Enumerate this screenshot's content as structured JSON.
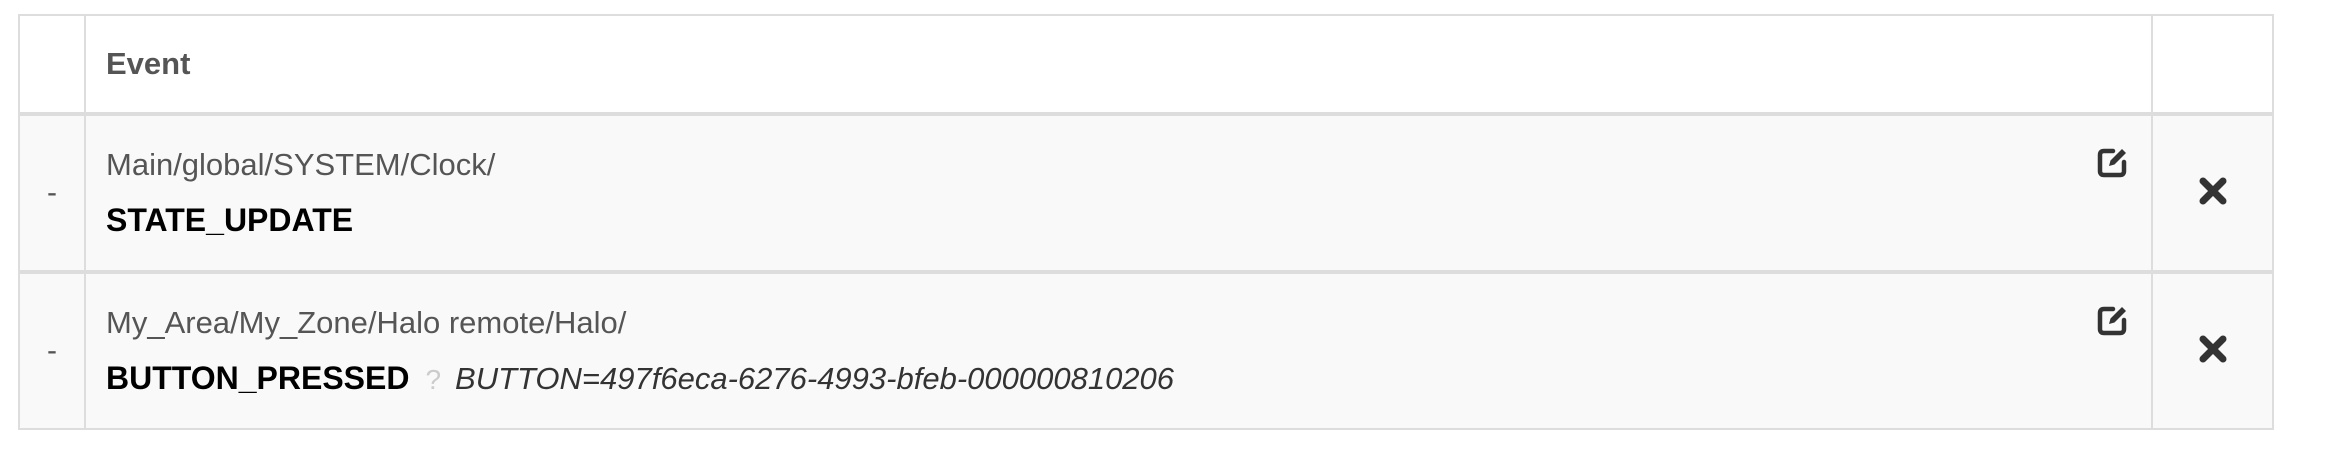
{
  "table": {
    "header": {
      "dash": "",
      "event": "Event",
      "actions": ""
    },
    "rows": [
      {
        "marker": "-",
        "path": "Main/global/SYSTEM/Clock/",
        "event_name": "STATE_UPDATE",
        "filter_separator": "",
        "filter": "",
        "edit_icon": "edit-icon",
        "delete_icon": "close-icon"
      },
      {
        "marker": "-",
        "path": "My_Area/My_Zone/Halo remote/Halo/",
        "event_name": "BUTTON_PRESSED",
        "filter_separator": "?",
        "filter": "BUTTON=497f6eca-6276-4993-bfeb-000000810206",
        "edit_icon": "edit-icon",
        "delete_icon": "close-icon"
      }
    ]
  },
  "colors": {
    "border": "#dddddd",
    "row_background": "#f9f9f9",
    "text": "#555555",
    "event_name": "#000000",
    "icon": "#333333"
  }
}
